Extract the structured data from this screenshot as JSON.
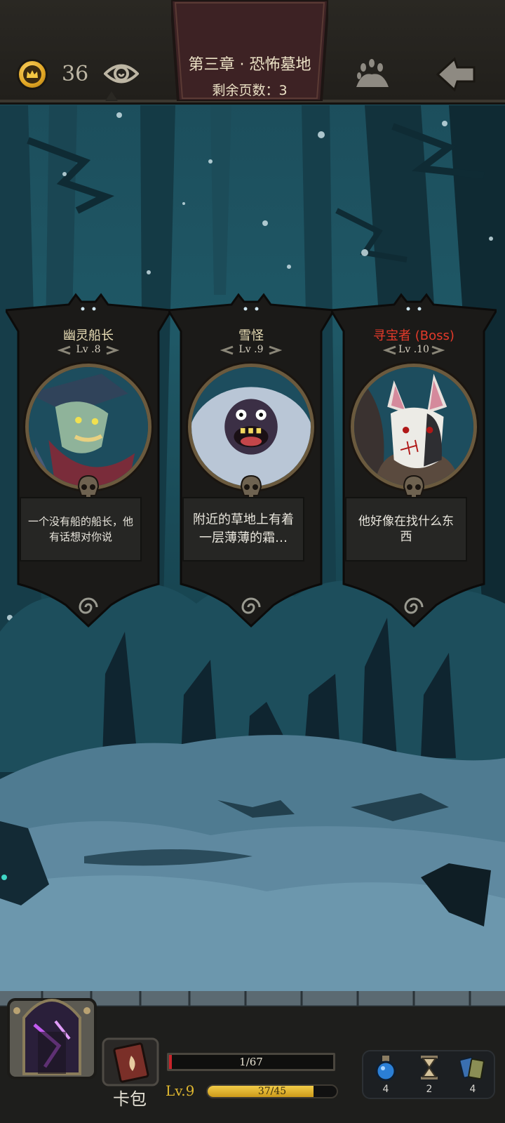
{
  "topbar": {
    "coins": "36",
    "chapter_title": "第三章 · 恐怖墓地",
    "pages_left": "剩余页数：3"
  },
  "encounters": [
    {
      "name": "幽灵船长",
      "level": "Lv .8",
      "desc": "一个没有船的船长，他有话想对你说",
      "boss": false
    },
    {
      "name": "雪怪",
      "level": "Lv .9",
      "desc": "附近的草地上有着一层薄薄的霜…",
      "boss": false
    },
    {
      "name": "寻宝者 (Boss)",
      "level": "Lv .10",
      "desc": "他好像在找什么东西",
      "boss": true
    }
  ],
  "player": {
    "bag_label": "卡包",
    "hp_text": "1/67",
    "hp_fraction": 0.015,
    "level": "Lv.9",
    "xp_text": "37/45",
    "xp_fraction": 0.82
  },
  "inventory": {
    "potion_count": "4",
    "hourglass_count": "2",
    "cards_count": "4"
  },
  "colors": {
    "boss_name": "#e43a2a",
    "normal_name": "#e8ddb5",
    "hp": "#c9232a",
    "xp": "#f2cc48"
  }
}
